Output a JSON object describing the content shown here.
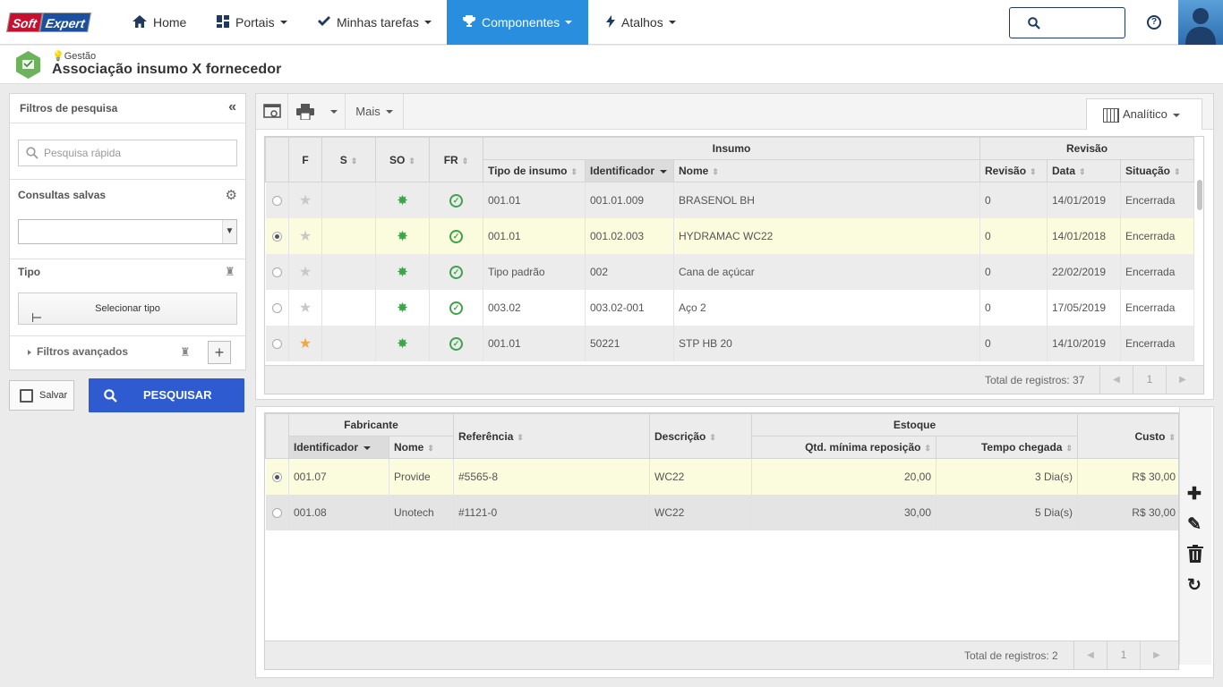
{
  "brand": {
    "part1": "Soft",
    "part2": "Expert"
  },
  "nav": [
    {
      "label": "Home",
      "icon": "home-icon"
    },
    {
      "label": "Portais",
      "icon": "dashboard-icon"
    },
    {
      "label": "Minhas tarefas",
      "icon": "check-icon"
    },
    {
      "label": "Componentes",
      "icon": "trophy-icon",
      "active": true
    },
    {
      "label": "Atalhos",
      "icon": "bolt-icon"
    }
  ],
  "header": {
    "breadcrumb": "Gestão",
    "title": "Associação insumo X fornecedor"
  },
  "filters": {
    "title": "Filtros de pesquisa",
    "quick_search_placeholder": "Pesquisa rápida",
    "saved_queries_label": "Consultas salvas",
    "type_label": "Tipo",
    "select_type_button": "Selecionar tipo",
    "advanced_filters": "Filtros avançados",
    "save_button": "Salvar",
    "search_button": "PESQUISAR"
  },
  "toolbar": {
    "more_label": "Mais",
    "view_mode": "Analítico"
  },
  "insumo_grid": {
    "group_insumo": "Insumo",
    "group_revisao": "Revisão",
    "columns": [
      "F",
      "S",
      "SO",
      "FR",
      "Tipo de insumo",
      "Identificador",
      "Nome",
      "Revisão",
      "Data",
      "Situação"
    ],
    "rows": [
      {
        "selected": false,
        "favorite": false,
        "tipo": "001.01",
        "id": "001.01.009",
        "nome": "BRASENOL BH",
        "revisao": "0",
        "data": "14/01/2019",
        "situacao": "Encerrada"
      },
      {
        "selected": true,
        "favorite": false,
        "tipo": "001.01",
        "id": "001.02.003",
        "nome": "HYDRAMAC WC22",
        "revisao": "0",
        "data": "14/01/2018",
        "situacao": "Encerrada"
      },
      {
        "selected": false,
        "favorite": false,
        "tipo": "Tipo padrão",
        "id": "002",
        "nome": "Cana de açúcar",
        "revisao": "0",
        "data": "22/02/2019",
        "situacao": "Encerrada"
      },
      {
        "selected": false,
        "favorite": false,
        "tipo": "003.02",
        "id": "003.02-001",
        "nome": "Aço 2",
        "revisao": "0",
        "data": "17/05/2019",
        "situacao": "Encerrada"
      },
      {
        "selected": false,
        "favorite": true,
        "tipo": "001.01",
        "id": "50221",
        "nome": "STP HB 20",
        "revisao": "0",
        "data": "14/10/2019",
        "situacao": "Encerrada"
      }
    ],
    "total": "Total de registros: 37",
    "page": "1"
  },
  "fornecedor_grid": {
    "group_fabricante": "Fabricante",
    "group_estoque": "Estoque",
    "columns": {
      "identificador": "Identificador",
      "nome": "Nome",
      "referencia": "Referência",
      "descricao": "Descrição",
      "qtd": "Qtd. mínima reposição",
      "tempo": "Tempo chegada",
      "custo": "Custo"
    },
    "rows": [
      {
        "selected": true,
        "id": "001.07",
        "nome": "Provide",
        "referencia": "#5565-8",
        "descricao": "WC22",
        "qtd": "20,00",
        "tempo": "3 Dia(s)",
        "custo": "R$ 30,00"
      },
      {
        "selected": false,
        "id": "001.08",
        "nome": "Unotech",
        "referencia": "#1121-0",
        "descricao": "WC22",
        "qtd": "30,00",
        "tempo": "5 Dia(s)",
        "custo": "R$ 30,00"
      }
    ],
    "total": "Total de registros: 2",
    "page": "1"
  }
}
